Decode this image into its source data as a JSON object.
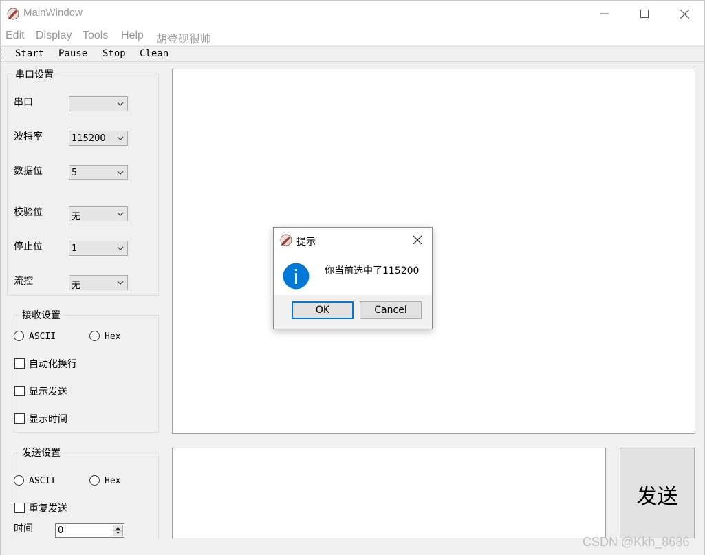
{
  "window": {
    "title": "MainWindow",
    "icon": "pen-app-icon",
    "min_icon": "minimize-icon",
    "max_icon": "maximize-icon",
    "close_icon": "close-icon"
  },
  "menu": [
    "Edit",
    "Display",
    "Tools",
    "Help",
    "胡登砚很帅"
  ],
  "toolbar": [
    "Start",
    "Pause",
    "Stop",
    "Clean"
  ],
  "serial_settings": {
    "title": "串口设置",
    "fields": [
      {
        "label": "串口",
        "value": ""
      },
      {
        "label": "波特率",
        "value": "115200"
      },
      {
        "label": "数据位",
        "value": "5"
      },
      {
        "label": "校验位",
        "value": "无"
      },
      {
        "label": "停止位",
        "value": "1"
      },
      {
        "label": "流控",
        "value": "无"
      }
    ]
  },
  "receive_settings": {
    "title": "接收设置",
    "radio_ascii": "ASCII",
    "radio_hex": "Hex",
    "checks": [
      "自动化换行",
      "显示发送",
      "显示时间"
    ]
  },
  "send_settings": {
    "title": "发送设置",
    "radio_ascii": "ASCII",
    "radio_hex": "Hex",
    "check_repeat": "重复发送",
    "time_label": "时间",
    "time_value": "0"
  },
  "send_button": "发送",
  "watermark": "CSDN @Kkh_8686",
  "dialog": {
    "title": "提示",
    "icon": "pen-app-icon",
    "info_icon": "info-icon",
    "message": "你当前选中了115200",
    "ok": "OK",
    "cancel": "Cancel"
  },
  "colors": {
    "accent": "#0078d7",
    "window_bg": "#f0f0f0",
    "disabled_text": "#999999"
  }
}
